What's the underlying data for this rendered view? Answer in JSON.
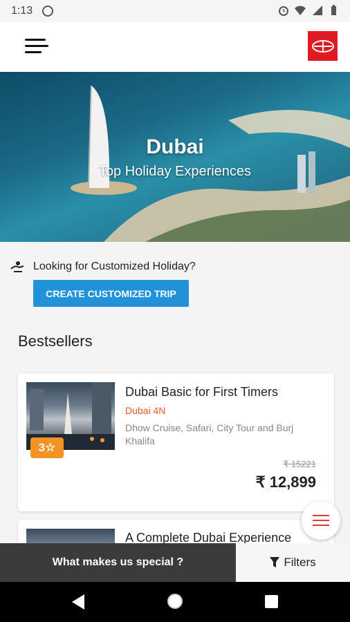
{
  "status": {
    "time": "1:13"
  },
  "hero": {
    "title": "Dubai",
    "subtitle": "Top Holiday Experiences"
  },
  "customize": {
    "prompt": "Looking for Customized Holiday?",
    "button_label": "CREATE CUSTOMIZED TRIP"
  },
  "section": {
    "title": "Bestsellers"
  },
  "packages": [
    {
      "title": "Dubai Basic for First Timers",
      "duration": "Dubai 4N",
      "description": "Dhow Cruise, Safari, City Tour and Burj Khalifa",
      "rating": "3☆",
      "old_price": "₹ 15221",
      "price": "₹ 12,899"
    },
    {
      "title": "A Complete Dubai Experience"
    }
  ],
  "bottom": {
    "special_label": "What makes us special ?",
    "filters_label": "Filters"
  },
  "colors": {
    "accent": "#2192d8",
    "brand": "#e01a22",
    "duration": "#f05a2a",
    "badge": "#f39324"
  },
  "icons": [
    "whatsapp-icon",
    "alarm-icon",
    "wifi-icon",
    "signal-icon",
    "battery-icon",
    "menu-icon",
    "customize-icon",
    "filter-icon",
    "back-icon",
    "home-icon",
    "recents-icon"
  ]
}
